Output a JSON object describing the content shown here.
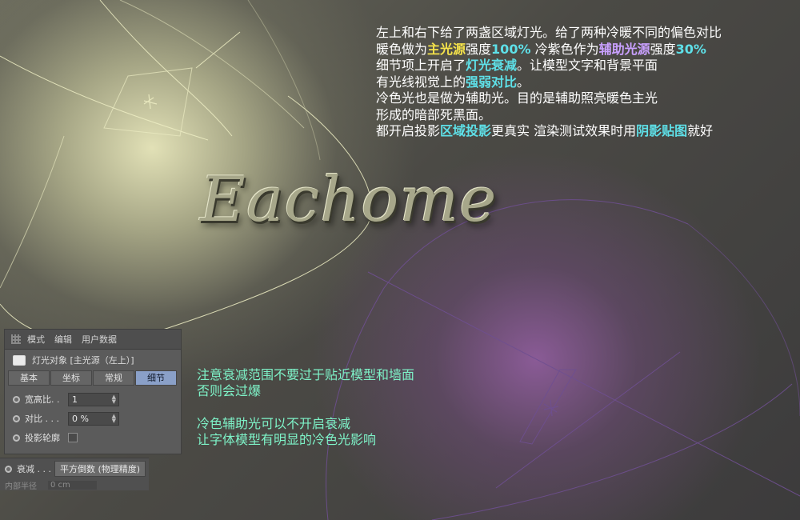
{
  "logo_text": "Eachome",
  "annotation": {
    "lines": [
      {
        "segments": [
          {
            "t": "左上和右下给了两盏区域灯光。给了两种冷暖不同的偏色对比",
            "c": ""
          }
        ]
      },
      {
        "segments": [
          {
            "t": "暖色做为",
            "c": ""
          },
          {
            "t": "主光源",
            "c": "hl-yellow"
          },
          {
            "t": "强度",
            "c": ""
          },
          {
            "t": "100%",
            "c": "hl-cyan"
          },
          {
            "t": "  冷紫色作为",
            "c": ""
          },
          {
            "t": "辅助光源",
            "c": "hl-purple"
          },
          {
            "t": "强度",
            "c": ""
          },
          {
            "t": "30%",
            "c": "hl-cyan"
          }
        ]
      },
      {
        "segments": [
          {
            "t": "细节项上开启了",
            "c": ""
          },
          {
            "t": "灯光衰减",
            "c": "hl-cyan"
          },
          {
            "t": "。让模型文字和背景平面",
            "c": ""
          }
        ]
      },
      {
        "segments": [
          {
            "t": "有光线视觉上的",
            "c": ""
          },
          {
            "t": "强弱对比",
            "c": "hl-cyan"
          },
          {
            "t": "。",
            "c": ""
          }
        ]
      },
      {
        "segments": [
          {
            "t": "冷色光也是做为辅助光。目的是辅助照亮暖色主光",
            "c": ""
          }
        ]
      },
      {
        "segments": [
          {
            "t": "形成的暗部死黑面。",
            "c": ""
          }
        ]
      },
      {
        "segments": [
          {
            "t": "都开启投影",
            "c": ""
          },
          {
            "t": "区域投影",
            "c": "hl-cyan"
          },
          {
            "t": "更真实  渲染测试效果时用",
            "c": ""
          },
          {
            "t": "阴影贴图",
            "c": "hl-cyan"
          },
          {
            "t": "就好",
            "c": ""
          }
        ]
      }
    ]
  },
  "tips": {
    "block1": [
      "注意衰减范围不要过于贴近模型和墙面",
      "否则会过爆"
    ],
    "block2": [
      "冷色辅助光可以不开启衰减",
      "让字体模型有明显的冷色光影响"
    ]
  },
  "panel": {
    "menu": [
      "模式",
      "编辑",
      "用户数据"
    ],
    "object_title": "灯光对象 [主光源（左上）]",
    "tabs": [
      "基本",
      "坐标",
      "常规",
      "细节"
    ],
    "active_tab": "细节",
    "props": {
      "aspect_label": "宽高比. .",
      "aspect_value": "1",
      "contrast_label": "对比 . . .",
      "contrast_value": "0 %",
      "shadow_outline_label": "投影轮廓"
    }
  },
  "panel2": {
    "falloff_label": "衰减 . . .",
    "falloff_value": "平方倒数 (物理精度)",
    "inner_radius_label": "内部半径",
    "inner_radius_value": "0 cm"
  },
  "colors": {
    "warm_light": "#e9e8bc",
    "cool_light": "#965fa5",
    "highlight_yellow": "#f4e24a",
    "highlight_cyan": "#5ee0e8",
    "highlight_purple": "#c9a0ff",
    "tip_text": "#7ef3c8",
    "active_tab": "#8aa0c8"
  }
}
